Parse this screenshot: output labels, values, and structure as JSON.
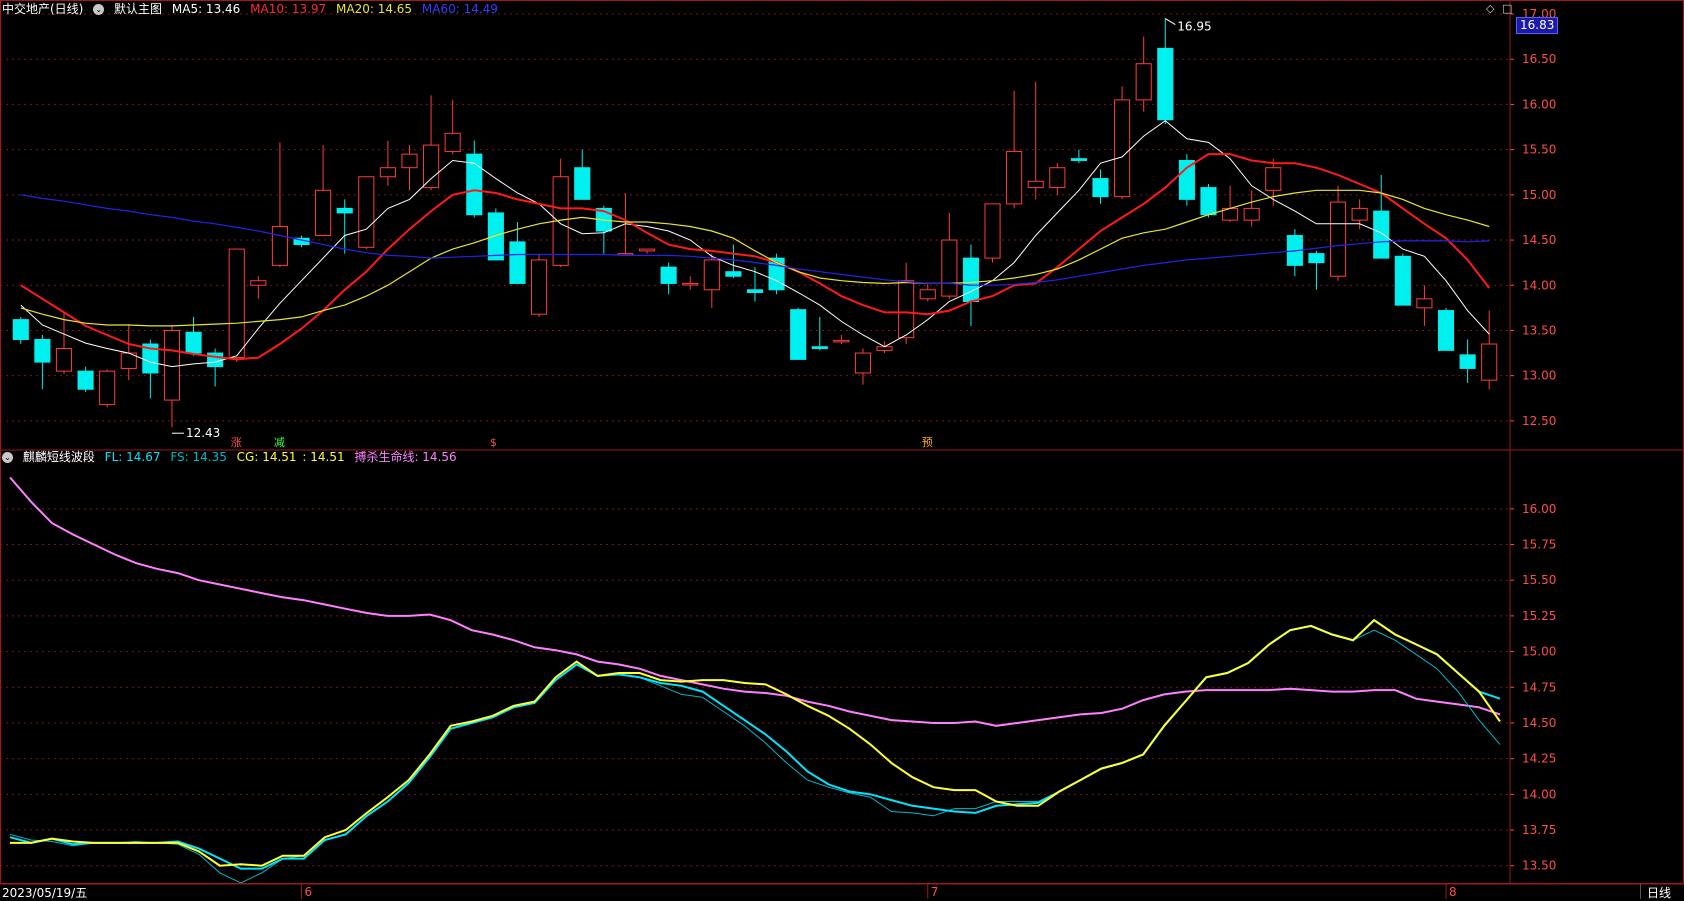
{
  "main_panel": {
    "stock_name": "中交地产(日线)",
    "template_label": "默认主图",
    "ma5_label": "MA5: 13.46",
    "ma10_label": "MA10: 13.97",
    "ma20_label": "MA20: 14.65",
    "ma60_label": "MA60: 14.49",
    "current_price_tag": "16.83",
    "high_marker": "16.95",
    "low_marker": "12.43",
    "signal_labels": [
      "涨",
      "减",
      "$",
      "预"
    ]
  },
  "sub_panel": {
    "indicator_name": "麒麟短线波段",
    "fl_label": "FL: 14.67",
    "fs_label": "FS: 14.35",
    "cg_label": "CG: 14.51",
    "cg2_label": ": 14.51",
    "life_label": "搏杀生命线: 14.56"
  },
  "bottom_bar": {
    "date": "2023/05/19/五",
    "month_labels": [
      "6",
      "7",
      "8"
    ],
    "period": "日线"
  },
  "colors": {
    "up": "#ff3b3b",
    "down": "#00f0f0",
    "ma5": "#ffffff",
    "ma10": "#ff1a1a",
    "ma20": "#e6e62e",
    "ma60": "#2323e6",
    "fl": "#00e5ff",
    "fs": "#00b8c8",
    "cg": "#ffff33",
    "life": "#ff80ff",
    "grid": "#7a1515",
    "axis_text": "#ff4d4d"
  },
  "chart_data": [
    {
      "type": "candlestick",
      "title": "中交地产(日线)",
      "ylim": [
        12.2,
        17.0
      ],
      "yticks": [
        "17.00",
        "16.50",
        "16.00",
        "15.50",
        "15.00",
        "14.50",
        "14.00",
        "13.50",
        "13.00",
        "12.50"
      ],
      "x_markers": [
        "6",
        "7",
        "8"
      ],
      "ohlc": [
        [
          13.62,
          13.65,
          13.35,
          13.4
        ],
        [
          13.4,
          13.45,
          12.85,
          13.15
        ],
        [
          13.05,
          13.7,
          13.02,
          13.3
        ],
        [
          13.05,
          13.1,
          12.82,
          12.85
        ],
        [
          12.68,
          13.07,
          12.65,
          13.05
        ],
        [
          13.08,
          13.57,
          12.95,
          13.25
        ],
        [
          13.35,
          13.4,
          12.75,
          13.03
        ],
        [
          12.73,
          13.56,
          12.43,
          13.5
        ],
        [
          13.48,
          13.65,
          13.22,
          13.25
        ],
        [
          13.25,
          13.3,
          12.88,
          13.1
        ],
        [
          13.2,
          14.4,
          13.15,
          14.4
        ],
        [
          14.0,
          14.1,
          13.85,
          14.05
        ],
        [
          14.22,
          15.58,
          14.2,
          14.65
        ],
        [
          14.52,
          14.55,
          14.42,
          14.45
        ],
        [
          14.55,
          15.55,
          14.55,
          15.05
        ],
        [
          14.85,
          14.95,
          14.35,
          14.8
        ],
        [
          14.42,
          15.0,
          14.4,
          15.2
        ],
        [
          15.2,
          15.6,
          15.1,
          15.3
        ],
        [
          15.3,
          15.55,
          15.05,
          15.45
        ],
        [
          15.08,
          16.1,
          15.05,
          15.55
        ],
        [
          15.48,
          16.05,
          15.45,
          15.68
        ],
        [
          15.45,
          15.6,
          14.75,
          14.78
        ],
        [
          14.8,
          14.85,
          14.38,
          14.28
        ],
        [
          14.48,
          14.7,
          14.02,
          14.02
        ],
        [
          13.68,
          14.35,
          13.65,
          14.28
        ],
        [
          14.22,
          15.4,
          14.2,
          15.2
        ],
        [
          15.3,
          15.5,
          14.95,
          14.95
        ],
        [
          14.85,
          14.88,
          14.35,
          14.6
        ],
        [
          14.35,
          15.02,
          14.35,
          14.35
        ],
        [
          14.38,
          14.4,
          14.35,
          14.4
        ],
        [
          14.2,
          14.25,
          13.9,
          14.02
        ],
        [
          14.02,
          14.1,
          13.95,
          14.02
        ],
        [
          13.95,
          14.35,
          13.75,
          14.28
        ],
        [
          14.15,
          14.45,
          14.08,
          14.1
        ],
        [
          13.95,
          14.2,
          13.82,
          13.92
        ],
        [
          14.3,
          14.35,
          13.9,
          13.95
        ],
        [
          13.73,
          13.75,
          13.18,
          13.18
        ],
        [
          13.32,
          13.65,
          13.28,
          13.3
        ],
        [
          13.38,
          13.45,
          13.35,
          13.39
        ],
        [
          13.03,
          13.3,
          12.9,
          13.25
        ],
        [
          13.28,
          13.38,
          13.25,
          13.32
        ],
        [
          13.42,
          14.25,
          13.35,
          14.05
        ],
        [
          13.85,
          14.02,
          13.82,
          13.95
        ],
        [
          13.88,
          14.8,
          13.85,
          14.5
        ],
        [
          14.3,
          14.45,
          13.55,
          13.82
        ],
        [
          14.3,
          14.75,
          14.25,
          14.9
        ],
        [
          14.9,
          16.15,
          14.85,
          15.48
        ],
        [
          15.08,
          16.25,
          14.95,
          15.15
        ],
        [
          15.08,
          15.35,
          15.0,
          15.3
        ],
        [
          15.4,
          15.5,
          15.35,
          15.38
        ],
        [
          15.18,
          15.28,
          14.9,
          14.98
        ],
        [
          14.98,
          16.2,
          14.95,
          16.05
        ],
        [
          16.05,
          16.75,
          15.92,
          16.45
        ],
        [
          16.62,
          16.95,
          15.78,
          15.83
        ],
        [
          15.38,
          15.45,
          14.88,
          14.95
        ],
        [
          15.08,
          15.12,
          14.75,
          14.78
        ],
        [
          14.72,
          15.1,
          14.7,
          14.85
        ],
        [
          14.72,
          15.05,
          14.65,
          14.85
        ],
        [
          15.05,
          15.4,
          14.88,
          15.3
        ],
        [
          14.55,
          14.62,
          14.1,
          14.22
        ],
        [
          14.35,
          14.38,
          13.95,
          14.25
        ],
        [
          14.1,
          15.1,
          14.05,
          14.92
        ],
        [
          14.72,
          14.95,
          14.62,
          14.85
        ],
        [
          14.82,
          15.22,
          14.3,
          14.3
        ],
        [
          14.32,
          14.35,
          13.78,
          13.78
        ],
        [
          13.75,
          14.0,
          13.55,
          13.85
        ],
        [
          13.72,
          13.75,
          13.28,
          13.28
        ],
        [
          13.23,
          13.4,
          12.92,
          13.08
        ],
        [
          12.95,
          13.72,
          12.85,
          13.35
        ]
      ],
      "series": [
        {
          "name": "MA5",
          "values": [
            13.78,
            13.56,
            13.46,
            13.36,
            13.3,
            13.25,
            13.15,
            13.1,
            13.13,
            13.15,
            13.22,
            13.52,
            13.8,
            14.05,
            14.3,
            14.55,
            14.62,
            14.85,
            14.95,
            15.18,
            15.38,
            15.35,
            15.18,
            15.02,
            14.9,
            14.68,
            14.57,
            14.58,
            14.68,
            14.65,
            14.6,
            14.5,
            14.32,
            14.22,
            14.15,
            14.05,
            13.92,
            13.78,
            13.6,
            13.45,
            13.32,
            13.45,
            13.62,
            13.82,
            13.93,
            14.05,
            14.25,
            14.55,
            14.8,
            15.05,
            15.35,
            15.42,
            15.65,
            15.82,
            15.62,
            15.58,
            15.4,
            15.1,
            14.95,
            14.82,
            14.68,
            14.68,
            14.68,
            14.58,
            14.4,
            14.32,
            14.05,
            13.72,
            13.46
          ]
        },
        {
          "name": "MA10",
          "values": [
            14.0,
            13.85,
            13.7,
            13.55,
            13.45,
            13.35,
            13.3,
            13.28,
            13.24,
            13.21,
            13.18,
            13.2,
            13.35,
            13.52,
            13.72,
            13.95,
            14.15,
            14.4,
            14.62,
            14.82,
            15.0,
            15.05,
            15.02,
            14.95,
            14.9,
            14.85,
            14.85,
            14.82,
            14.72,
            14.58,
            14.45,
            14.4,
            14.38,
            14.35,
            14.32,
            14.25,
            14.15,
            14.02,
            13.88,
            13.78,
            13.7,
            13.7,
            13.68,
            13.72,
            13.82,
            13.88,
            14.0,
            14.02,
            14.2,
            14.4,
            14.6,
            14.75,
            14.9,
            15.08,
            15.3,
            15.45,
            15.45,
            15.38,
            15.35,
            15.35,
            15.3,
            15.22,
            15.12,
            15.02,
            14.85,
            14.68,
            14.52,
            14.28,
            13.97
          ]
        },
        {
          "name": "MA20",
          "values": [
            13.75,
            13.68,
            13.62,
            13.58,
            13.56,
            13.56,
            13.55,
            13.55,
            13.56,
            13.57,
            13.58,
            13.6,
            13.62,
            13.65,
            13.72,
            13.78,
            13.88,
            14.0,
            14.15,
            14.3,
            14.4,
            14.47,
            14.55,
            14.62,
            14.68,
            14.72,
            14.75,
            14.72,
            14.7,
            14.7,
            14.68,
            14.65,
            14.6,
            14.52,
            14.38,
            14.25,
            14.15,
            14.08,
            14.05,
            14.03,
            14.02,
            14.03,
            14.02,
            14.02,
            14.03,
            14.05,
            14.08,
            14.12,
            14.18,
            14.28,
            14.4,
            14.52,
            14.58,
            14.62,
            14.7,
            14.78,
            14.85,
            14.92,
            14.98,
            15.02,
            15.05,
            15.05,
            15.05,
            15.02,
            14.95,
            14.85,
            14.78,
            14.72,
            14.65
          ]
        },
        {
          "name": "MA60",
          "values": [
            15.0,
            14.96,
            14.93,
            14.89,
            14.85,
            14.82,
            14.78,
            14.75,
            14.71,
            14.68,
            14.64,
            14.6,
            14.55,
            14.5,
            14.45,
            14.4,
            14.36,
            14.33,
            14.32,
            14.3,
            14.31,
            14.32,
            14.33,
            14.34,
            14.34,
            14.34,
            14.34,
            14.34,
            14.33,
            14.33,
            14.33,
            14.32,
            14.3,
            14.28,
            14.25,
            14.22,
            14.18,
            14.15,
            14.12,
            14.09,
            14.06,
            14.04,
            14.02,
            14.02,
            14.0,
            14.0,
            14.01,
            14.03,
            14.06,
            14.1,
            14.14,
            14.18,
            14.22,
            14.25,
            14.28,
            14.3,
            14.32,
            14.34,
            14.36,
            14.38,
            14.41,
            14.44,
            14.46,
            14.48,
            14.49,
            14.49,
            14.49,
            14.48,
            14.49
          ]
        }
      ]
    },
    {
      "type": "line",
      "title": "麒麟短线波段",
      "ylim": [
        13.4,
        16.3
      ],
      "yticks": [
        "16.00",
        "15.75",
        "15.50",
        "15.25",
        "15.00",
        "14.75",
        "14.50",
        "14.25",
        "14.00",
        "13.75",
        "13.50"
      ],
      "series": [
        {
          "name": "搏杀生命线",
          "values": [
            16.22,
            16.05,
            15.9,
            15.82,
            15.75,
            15.68,
            15.62,
            15.58,
            15.55,
            15.5,
            15.47,
            15.44,
            15.41,
            15.38,
            15.36,
            15.33,
            15.3,
            15.27,
            15.25,
            15.25,
            15.26,
            15.22,
            15.15,
            15.12,
            15.08,
            15.03,
            15.01,
            14.98,
            14.93,
            14.91,
            14.88,
            14.83,
            14.8,
            14.77,
            14.74,
            14.72,
            14.71,
            14.69,
            14.65,
            14.62,
            14.58,
            14.55,
            14.52,
            14.51,
            14.5,
            14.5,
            14.51,
            14.48,
            14.5,
            14.52,
            14.54,
            14.56,
            14.57,
            14.6,
            14.66,
            14.7,
            14.72,
            14.73,
            14.73,
            14.73,
            14.73,
            14.74,
            14.73,
            14.72,
            14.72,
            14.73,
            14.73,
            14.67,
            14.65,
            14.63,
            14.61,
            14.56
          ]
        },
        {
          "name": "CG",
          "values": [
            13.66,
            13.66,
            13.69,
            13.67,
            13.66,
            13.66,
            13.66,
            13.66,
            13.66,
            13.6,
            13.5,
            13.51,
            13.5,
            13.57,
            13.57,
            13.7,
            13.75,
            13.87,
            13.98,
            14.1,
            14.28,
            14.48,
            14.51,
            14.55,
            14.62,
            14.65,
            14.82,
            14.93,
            14.83,
            14.85,
            14.85,
            14.8,
            14.79,
            14.8,
            14.8,
            14.78,
            14.77,
            14.7,
            14.62,
            14.55,
            14.46,
            14.35,
            14.22,
            14.12,
            14.05,
            14.03,
            14.03,
            13.95,
            13.92,
            13.92,
            14.02,
            14.1,
            14.18,
            14.22,
            14.28,
            14.48,
            14.65,
            14.82,
            14.85,
            14.92,
            15.05,
            15.15,
            15.18,
            15.12,
            15.08,
            15.22,
            15.12,
            15.05,
            14.98,
            14.85,
            14.72,
            14.51
          ]
        },
        {
          "name": "FL",
          "values": [
            13.7,
            13.66,
            13.69,
            13.65,
            13.66,
            13.66,
            13.66,
            13.66,
            13.67,
            13.62,
            13.55,
            13.48,
            13.48,
            13.55,
            13.55,
            13.68,
            13.72,
            13.85,
            13.95,
            14.08,
            14.26,
            14.46,
            14.5,
            14.54,
            14.61,
            14.64,
            14.8,
            14.91,
            14.83,
            14.84,
            14.82,
            14.78,
            14.76,
            14.72,
            14.62,
            14.52,
            14.42,
            14.3,
            14.16,
            14.07,
            14.02,
            14.0,
            13.96,
            13.92,
            13.9,
            13.88,
            13.87,
            13.92,
            13.93,
            13.94,
            14.02,
            14.1,
            14.18,
            14.22,
            14.28,
            14.48,
            14.65,
            14.82,
            14.85,
            14.92,
            15.05,
            15.15,
            15.18,
            15.12,
            15.08,
            15.22,
            15.12,
            15.05,
            14.98,
            14.85,
            14.72,
            14.67
          ]
        },
        {
          "name": "FS",
          "values": [
            13.72,
            13.68,
            13.67,
            13.64,
            13.66,
            13.66,
            13.67,
            13.66,
            13.65,
            13.58,
            13.45,
            13.38,
            13.45,
            13.55,
            13.57,
            13.7,
            13.75,
            13.87,
            13.98,
            14.1,
            14.28,
            14.48,
            14.51,
            14.55,
            14.62,
            14.65,
            14.82,
            14.93,
            14.83,
            14.84,
            14.82,
            14.76,
            14.7,
            14.68,
            14.58,
            14.48,
            14.36,
            14.22,
            14.1,
            14.05,
            14.01,
            13.98,
            13.88,
            13.87,
            13.85,
            13.9,
            13.9,
            13.95,
            13.95,
            13.95,
            14.02,
            14.1,
            14.18,
            14.22,
            14.28,
            14.48,
            14.65,
            14.82,
            14.85,
            14.92,
            15.05,
            15.15,
            15.18,
            15.12,
            15.08,
            15.15,
            15.08,
            14.98,
            14.88,
            14.72,
            14.52,
            14.35
          ]
        }
      ]
    }
  ]
}
